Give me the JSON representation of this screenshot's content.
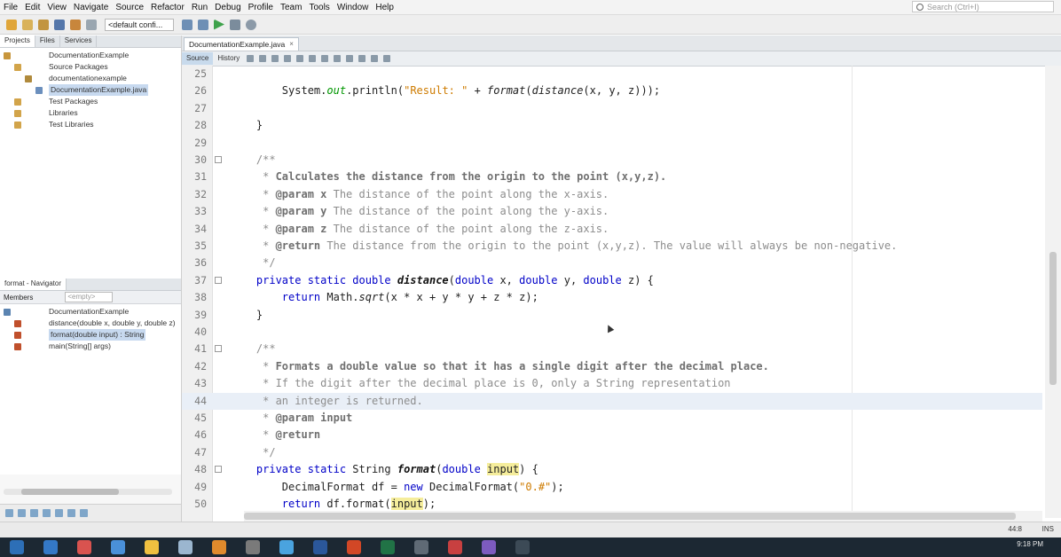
{
  "menu": [
    "File",
    "Edit",
    "View",
    "Navigate",
    "Source",
    "Refactor",
    "Run",
    "Debug",
    "Profile",
    "Team",
    "Tools",
    "Window",
    "Help"
  ],
  "search_placeholder": "Search (Ctrl+I)",
  "toolbar": {
    "config": "<default confi..."
  },
  "projects": {
    "tabs": [
      "Projects",
      "Files",
      "Services"
    ],
    "tree": [
      {
        "label": "DocumentationExample",
        "depth": 0
      },
      {
        "label": "Source Packages",
        "depth": 1
      },
      {
        "label": "documentationexample",
        "depth": 2
      },
      {
        "label": "DocumentationExample.java",
        "depth": 3,
        "selected": true
      },
      {
        "label": "Test Packages",
        "depth": 1
      },
      {
        "label": "Libraries",
        "depth": 1
      },
      {
        "label": "Test Libraries",
        "depth": 1
      }
    ]
  },
  "navigator": {
    "tabs": [
      "format - Navigator"
    ],
    "members_label": "Members",
    "filter": "<empty>",
    "tree": [
      {
        "label": "DocumentationExample",
        "depth": 0
      },
      {
        "label": "distance(double x, double y, double z)",
        "depth": 1
      },
      {
        "label": "format(double input) : String",
        "depth": 1,
        "selected": true
      },
      {
        "label": "main(String[] args)",
        "depth": 1
      }
    ]
  },
  "editor": {
    "file_tab": "DocumentationExample.java",
    "subtabs": [
      "Source",
      "History"
    ],
    "current_line": 44
  },
  "code": [
    {
      "n": "25",
      "parts": []
    },
    {
      "n": "26",
      "parts": [
        [
          "",
          "        System."
        ],
        [
          "fld",
          "out"
        ],
        [
          "",
          ".println("
        ],
        [
          "str",
          "\"Result: \""
        ],
        [
          "",
          " + "
        ],
        [
          "ital",
          "format"
        ],
        [
          "",
          "("
        ],
        [
          "ital",
          "distance"
        ],
        [
          "",
          "(x, y, z)));"
        ]
      ]
    },
    {
      "n": "27",
      "parts": []
    },
    {
      "n": "28",
      "parts": [
        [
          "",
          "    }"
        ]
      ]
    },
    {
      "n": "29",
      "parts": []
    },
    {
      "n": "30",
      "fold": true,
      "parts": [
        [
          "cm",
          "    /**"
        ]
      ]
    },
    {
      "n": "31",
      "parts": [
        [
          "cm",
          "     * "
        ],
        [
          "cmb",
          "Calculates the distance from the origin to the point (x,y,z)."
        ]
      ]
    },
    {
      "n": "32",
      "parts": [
        [
          "cm",
          "     * "
        ],
        [
          "tag",
          "@param x"
        ],
        [
          "cm",
          " The distance of the point along the x-axis."
        ]
      ]
    },
    {
      "n": "33",
      "parts": [
        [
          "cm",
          "     * "
        ],
        [
          "tag",
          "@param y"
        ],
        [
          "cm",
          " The distance of the point along the y-axis."
        ]
      ]
    },
    {
      "n": "34",
      "parts": [
        [
          "cm",
          "     * "
        ],
        [
          "tag",
          "@param z"
        ],
        [
          "cm",
          " The distance of the point along the z-axis."
        ]
      ]
    },
    {
      "n": "35",
      "parts": [
        [
          "cm",
          "     * "
        ],
        [
          "tag",
          "@return"
        ],
        [
          "cm",
          " The distance from the origin to the point (x,y,z). The value will always be non-negative."
        ]
      ]
    },
    {
      "n": "36",
      "parts": [
        [
          "cm",
          "     */"
        ]
      ]
    },
    {
      "n": "37",
      "fold": true,
      "parts": [
        [
          "kw",
          "    private static double "
        ],
        [
          "fn",
          "distance"
        ],
        [
          "",
          "("
        ],
        [
          "kw",
          "double"
        ],
        [
          "",
          " x, "
        ],
        [
          "kw",
          "double"
        ],
        [
          "",
          " y, "
        ],
        [
          "kw",
          "double"
        ],
        [
          "",
          " z) {"
        ]
      ]
    },
    {
      "n": "38",
      "parts": [
        [
          "kw",
          "        return "
        ],
        [
          "",
          "Math."
        ],
        [
          "ital",
          "sqrt"
        ],
        [
          "",
          "(x * x + y * y + z * z);"
        ]
      ]
    },
    {
      "n": "39",
      "parts": [
        [
          "",
          "    }"
        ]
      ]
    },
    {
      "n": "40",
      "parts": []
    },
    {
      "n": "41",
      "fold": true,
      "parts": [
        [
          "cm",
          "    /**"
        ]
      ]
    },
    {
      "n": "42",
      "parts": [
        [
          "cm",
          "     * "
        ],
        [
          "cmb",
          "Formats a double value so that it has a single digit after the decimal place."
        ]
      ]
    },
    {
      "n": "43",
      "parts": [
        [
          "cm",
          "     * If the digit after the decimal place is 0, only a String representation"
        ]
      ]
    },
    {
      "n": "44",
      "parts": [
        [
          "cm",
          "     * an integer is returned."
        ]
      ]
    },
    {
      "n": "45",
      "parts": [
        [
          "cm",
          "     * "
        ],
        [
          "tag",
          "@param"
        ],
        [
          "",
          ""
        ],
        [
          "cmb",
          " input"
        ]
      ]
    },
    {
      "n": "46",
      "parts": [
        [
          "cm",
          "     * "
        ],
        [
          "tag",
          "@return"
        ]
      ]
    },
    {
      "n": "47",
      "parts": [
        [
          "cm",
          "     */"
        ]
      ]
    },
    {
      "n": "48",
      "fold": true,
      "parts": [
        [
          "kw",
          "    private static "
        ],
        [
          "",
          "String "
        ],
        [
          "fn",
          "format"
        ],
        [
          "",
          "("
        ],
        [
          "kw",
          "double "
        ],
        [
          "hl",
          "input"
        ],
        [
          "",
          ") {"
        ]
      ]
    },
    {
      "n": "49",
      "parts": [
        [
          "",
          "        DecimalFormat df = "
        ],
        [
          "kw",
          "new "
        ],
        [
          "",
          "DecimalFormat("
        ],
        [
          "str",
          "\"0.#\""
        ],
        [
          "",
          ");"
        ]
      ]
    },
    {
      "n": "50",
      "parts": [
        [
          "kw",
          "        return "
        ],
        [
          "",
          "df.format("
        ],
        [
          "hl",
          "input"
        ],
        [
          "",
          ");"
        ]
      ]
    }
  ],
  "status": {
    "position": "44:8",
    "mode": "INS"
  },
  "taskbar": {
    "time": "9:18 PM"
  },
  "colors": {
    "keyword": "#0000c8",
    "string": "#ce7b00",
    "comment": "#8d8d8d",
    "field": "#009600",
    "highlight": "#f5ed9b"
  }
}
